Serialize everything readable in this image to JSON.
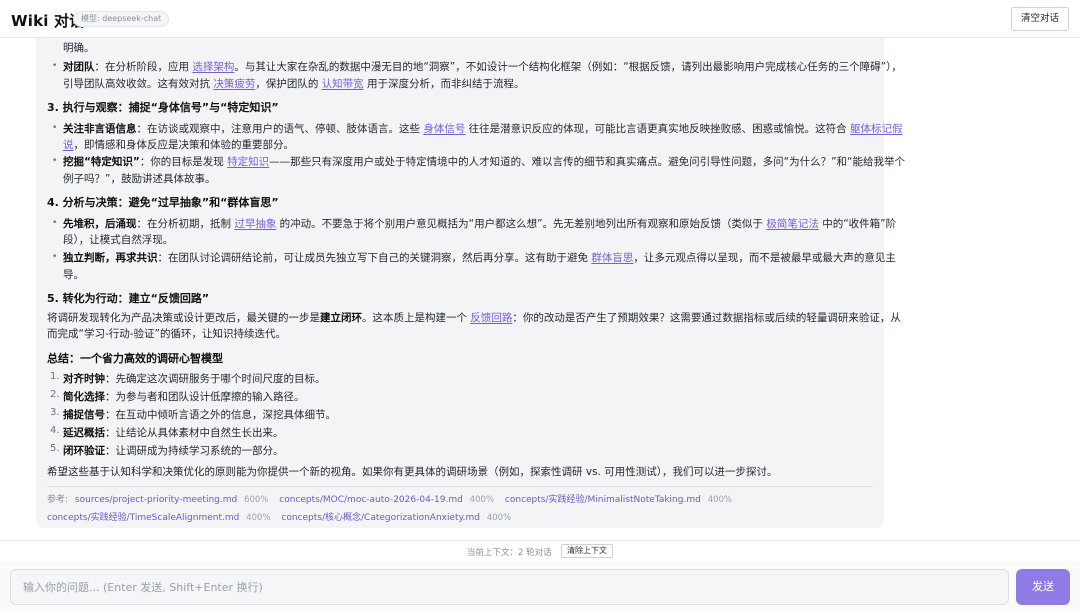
{
  "header": {
    "title": "Wiki 对话",
    "model_badge": "模型: deepseek-chat",
    "clear_button": "清空对话"
  },
  "message": {
    "l_top": "明确。",
    "team": {
      "label": "对团队",
      "t1": "：在分析阶段，应用 ",
      "link1": "选择架构",
      "t2": "。与其让大家在杂乱的数据中漫无目的地“洞察”，不如设计一个结构化框架（例如：“根据反馈，请列出最影响用户完成核心任务的三个障碍”），",
      "t3": "引导团队高效收敛。这有效对抗 ",
      "link2": "决策疲劳",
      "t4": "，保护团队的 ",
      "link3": "认知带宽",
      "t5": " 用于深度分析，而非纠结于流程。"
    },
    "sec3_heading": "3. 执行与观察：捕捉“身体信号”与“特定知识”",
    "nonverbal": {
      "label": "关注非言语信息",
      "t1": "：在访谈或观察中，注意用户的语气、停顿、肢体语言。这些 ",
      "link1": "身体信号",
      "t2": " 往往是潜意识反应的体现，可能比言语更真实地反映挫败感、困惑或愉悦。这符合 ",
      "link2a": "躯体标记假",
      "link2b": "说",
      "t3": "，即情感和身体反应是决策和体验的重要部分。"
    },
    "tacit": {
      "label": "挖掘“特定知识”",
      "t1": "：你的目标是发现 ",
      "link1": "特定知识",
      "t2": "——那些只有深度用户或处于特定情境中的人才知道的、难以言传的细节和真实痛点。避免问引导性问题，多问“为什么？”和“能给我举个",
      "t3": "例子吗？”，鼓励讲述具体故事。"
    },
    "sec4_heading": "4. 分析与决策：避免“过早抽象”和“群体盲思”",
    "stack": {
      "label": "先堆积，后涌现",
      "t1": "：在分析初期，抵制 ",
      "link1": "过早抽象",
      "t2": " 的冲动。不要急于将个别用户意见概括为“用户都这么想”。先无差别地列出所有观察和原始反馈（类似于 ",
      "link2": "极简笔记法",
      "t3": " 中的“收件箱”阶",
      "t4": "段），让模式自然浮现。"
    },
    "independent": {
      "label": "独立判断，再求共识",
      "t1": "：在团队讨论调研结论前，可让成员先独立写下自己的关键洞察，然后再分享。这有助于避免 ",
      "link1": "群体盲思",
      "t2": "，让多元观点得以呈现，而不是被最早或最大声的意见主",
      "t3": "导。"
    },
    "sec5_heading": "5. 转化为行动：建立“反馈回路”",
    "action": {
      "t1": "将调研发现转化为产品决策或设计更改后，最关键的一步是",
      "bold": "建立闭环",
      "t2": "。这本质上是构建一个 ",
      "link1": "反馈回路",
      "t3": "：你的改动是否产生了预期效果？这需要通过数据指标或后续的轻量调研来验证，从",
      "t4": "而完成“学习-行动-验证”的循环，让知识持续迭代。"
    },
    "summary_heading": "总结：一个省力高效的调研心智模型",
    "summary_items": [
      {
        "num": "1.",
        "label": "对齐时钟",
        "text": "：先确定这次调研服务于哪个时间尺度的目标。"
      },
      {
        "num": "2.",
        "label": "简化选择",
        "text": "：为参与者和团队设计低摩擦的输入路径。"
      },
      {
        "num": "3.",
        "label": "捕捉信号",
        "text": "：在互动中倾听言语之外的信息，深挖具体细节。"
      },
      {
        "num": "4.",
        "label": "延迟概括",
        "text": "：让结论从具体素材中自然生长出来。"
      },
      {
        "num": "5.",
        "label": "闭环验证",
        "text": "：让调研成为持续学习系统的一部分。"
      }
    ],
    "closing": "希望这些基于认知科学和决策优化的原则能为你提供一个新的视角。如果你有更具体的调研场景（例如，探索性调研 vs. 可用性测试），我们可以进一步探讨。",
    "refs_label": "参考:",
    "refs": [
      {
        "path": "sources/project-priority-meeting.md",
        "pct": "600%"
      },
      {
        "path": "concepts/MOC/moc-auto-2026-04-19.md",
        "pct": "400%"
      },
      {
        "path": "concepts/实践经验/MinimalistNoteTaking.md",
        "pct": "400%"
      },
      {
        "path": "concepts/实践经验/TimeScaleAlignment.md",
        "pct": "400%"
      },
      {
        "path": "concepts/核心概念/CategorizationAnxiety.md",
        "pct": "400%"
      }
    ]
  },
  "context": {
    "text": "当前上下文：2 轮对话",
    "clear_button": "清除上下文"
  },
  "input": {
    "placeholder": "输入你的问题... (Enter 发送, Shift+Enter 换行)",
    "send_button": "发送"
  },
  "colors": {
    "accent": "#8f7be3",
    "link": "#7b5cd6",
    "bubble_bg": "#f3f4f6"
  }
}
